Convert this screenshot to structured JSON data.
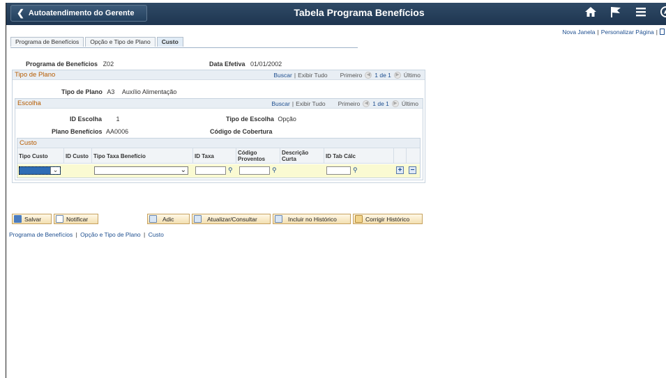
{
  "header": {
    "back_label": "Autoatendimento do Gerente",
    "title": "Tabela Programa Benefícios",
    "icons": [
      "home-icon",
      "flag-icon",
      "menu-icon",
      "navbar-icon"
    ]
  },
  "top_links": {
    "new_window": "Nova Janela",
    "sep": "|",
    "customize": "Personalizar Página",
    "sep2": "|"
  },
  "tabs": [
    {
      "label": "Programa de Benefícios",
      "active": false
    },
    {
      "label": "Opção e Tipo de Plano",
      "active": false
    },
    {
      "label": "Custo",
      "active": true
    }
  ],
  "summary": {
    "program_label": "Programa de Benefícios",
    "program_value": "Z02",
    "effdate_label": "Data Efetiva",
    "effdate_value": "01/01/2002"
  },
  "plan_group": {
    "title": "Tipo de Plano",
    "find": "Buscar",
    "sep": "|",
    "view_all": "Exibir Tudo",
    "first": "Primeiro",
    "count": "1 de 1",
    "last": "Último",
    "plan_type_label": "Tipo de Plano",
    "plan_type_value": "A3",
    "plan_type_desc": "Auxílio Alimentação"
  },
  "option_group": {
    "title": "Escolha",
    "find": "Buscar",
    "sep": "|",
    "view_all": "Exibir Tudo",
    "first": "Primeiro",
    "count": "1 de 1",
    "last": "Último",
    "option_id_label": "ID Escolha",
    "option_id_value": "1",
    "option_type_label": "Tipo de Escolha",
    "option_type_value": "Opção",
    "benefit_plan_label": "Plano Benefícios",
    "benefit_plan_value": "AA0006",
    "coverage_label": "Código de Cobertura"
  },
  "cost_grid": {
    "title": "Custo",
    "columns": [
      "Tipo Custo",
      "ID Custo",
      "Tipo Taxa Benefício",
      "ID Taxa",
      "Código Proventos",
      "Descrição Curta",
      "ID Tab Cálc"
    ]
  },
  "toolbar": {
    "save": "Salvar",
    "notify": "Notificar",
    "add": "Adic",
    "update": "Atualizar/Consultar",
    "include_history": "Incluir no Histórico",
    "correct_history": "Corrigir Histórico"
  },
  "bottom_links": {
    "link1": "Programa de Benefícios",
    "sep": "|",
    "link2": "Opção e Tipo de Plano",
    "link3": "Custo"
  },
  "colors": {
    "banner": "#1e3550",
    "group_title": "#b65b00",
    "link": "#1d4e8f",
    "row_highlight": "#fafad2"
  }
}
